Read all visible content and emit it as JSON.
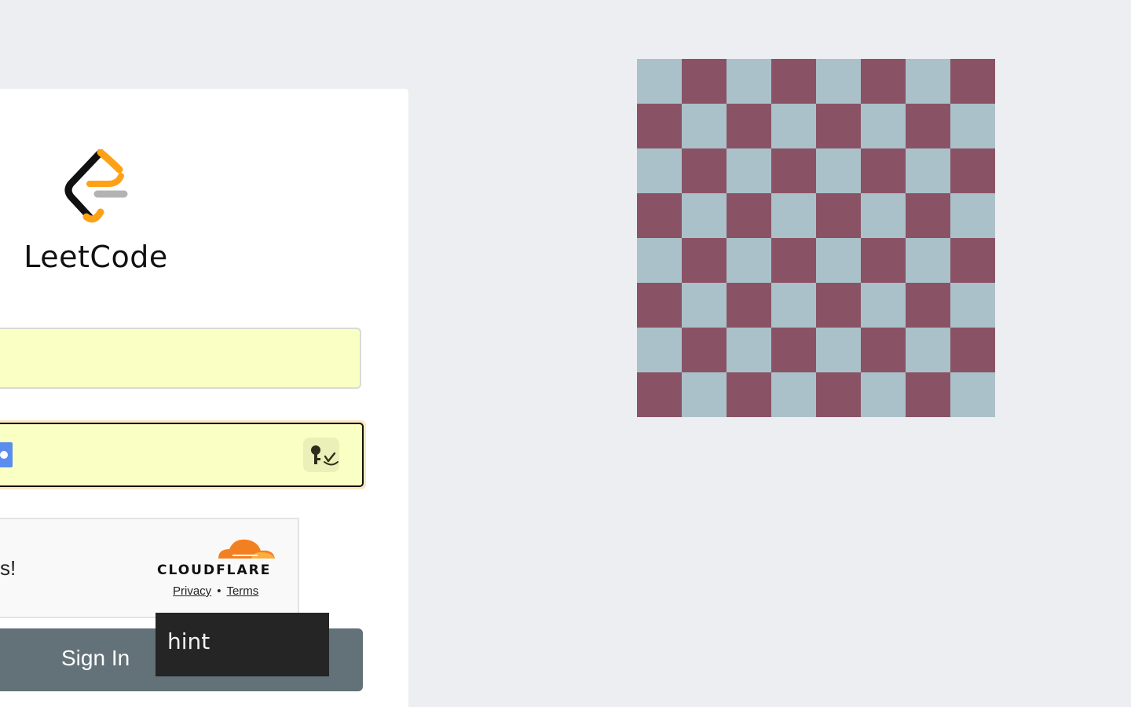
{
  "brand": {
    "name": "LeetCode"
  },
  "login_form": {
    "username_value": "",
    "password_value": "",
    "submit_label": "Sign In"
  },
  "captcha": {
    "message_fragment": "s!",
    "provider": "CLOUDFLARE",
    "privacy_label": "Privacy",
    "separator": "•",
    "terms_label": "Terms"
  },
  "tooltip": {
    "text": "hint"
  },
  "board": {
    "rows": 8,
    "cols": 8,
    "light_color": "#abc1c9",
    "dark_color": "#895365"
  },
  "colors": {
    "autofill_bg": "#faffc4",
    "button_bg": "#637178",
    "cloudflare_orange": "#f38020",
    "logo_orange": "#ffa116"
  }
}
